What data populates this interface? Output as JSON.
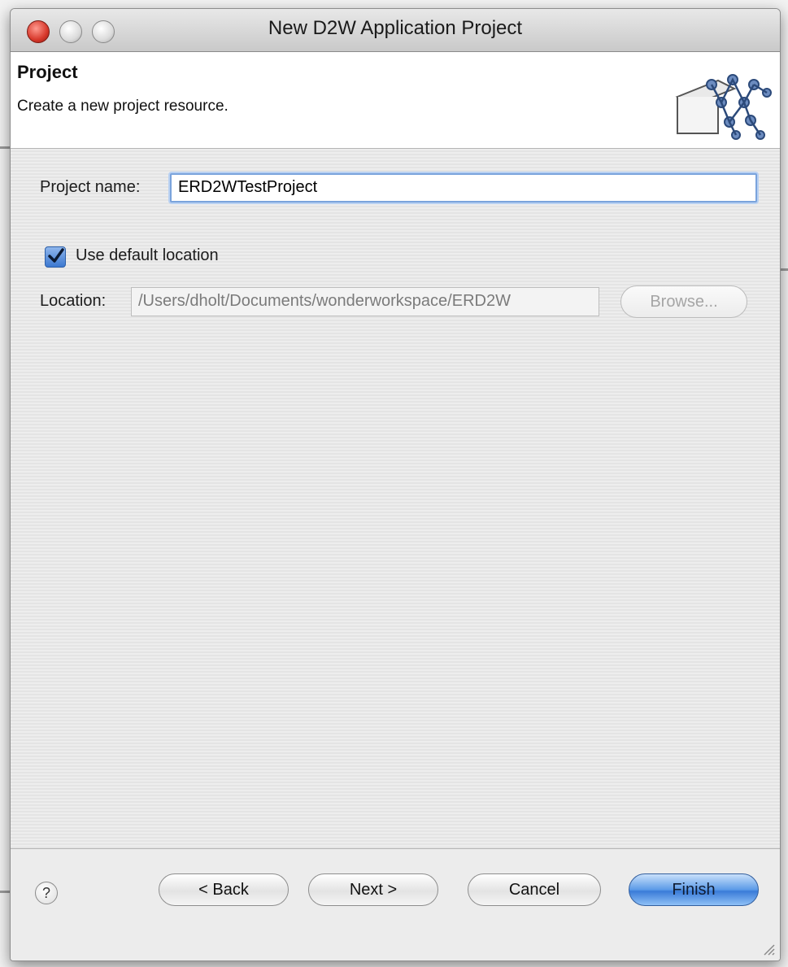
{
  "window": {
    "title": "New D2W Application Project"
  },
  "header": {
    "title": "Project",
    "description": "Create a new project resource."
  },
  "form": {
    "project_name_label": "Project name:",
    "project_name_value": "ERD2WTestProject",
    "use_default_label": "Use default location",
    "use_default_checked": true,
    "location_label": "Location:",
    "location_value": "/Users/dholt/Documents/wonderworkspace/ERD2W",
    "browse_label": "Browse..."
  },
  "footer": {
    "help_glyph": "?",
    "back_label": "< Back",
    "next_label": "Next >",
    "cancel_label": "Cancel",
    "finish_label": "Finish"
  },
  "colors": {
    "accent": "#3a7bd8",
    "focus_ring": "#7aa3dc",
    "close_button": "#d7382b"
  },
  "icons": [
    "close-window-icon",
    "minimize-window-icon",
    "zoom-window-icon",
    "wizard-banner-icon",
    "checkmark-icon",
    "help-icon",
    "resize-grip-icon"
  ]
}
